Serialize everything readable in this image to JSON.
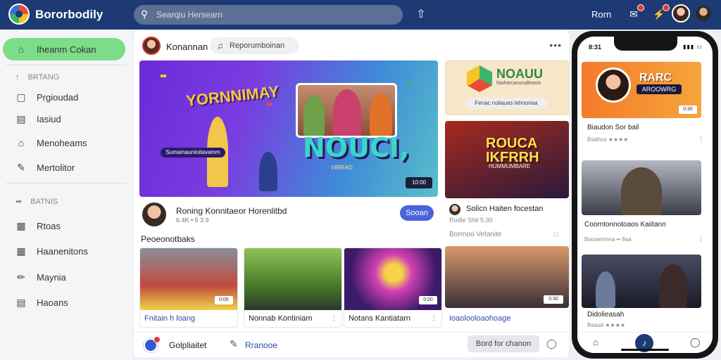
{
  "app": {
    "brand": "Bororbodily"
  },
  "search": {
    "placeholder": "Searqiu Hersearn"
  },
  "user": {
    "name": "Rorn"
  },
  "sidebar": {
    "active": {
      "label": "Iheanm Cokan"
    },
    "section1": {
      "heading": "BRTANG",
      "items": [
        {
          "label": "Prgioudad"
        },
        {
          "label": "Iasiud"
        },
        {
          "label": "Menoheams"
        },
        {
          "label": "Mertolitor"
        }
      ]
    },
    "section2": {
      "heading": "BATNIS",
      "items": [
        {
          "label": "Rtoas"
        },
        {
          "label": "Haanenitons"
        },
        {
          "label": "Maynia"
        },
        {
          "label": "Haoans"
        }
      ]
    }
  },
  "channel": {
    "owner": "Konannan",
    "chip": "Reporumboinan"
  },
  "hero": {
    "title": "YORNNIMAY",
    "big_text": "NOUCI,",
    "sub_text": "VIRRAO",
    "chip": "Sumamaunioitavamm",
    "duration": "10:00",
    "video_title": "Roning Konnitaeor Horenlitbd",
    "stats": "6.4K • 5 3.9",
    "subscribe": "Sooan"
  },
  "recommended": {
    "label": "Peoeonotbaks",
    "items": [
      {
        "caption": "Fnitain h loang",
        "duration": "0:00"
      },
      {
        "caption": "Nonnab Kontiniam",
        "duration": ""
      },
      {
        "caption": "Notans Kantiatarn",
        "duration": "0:00"
      }
    ]
  },
  "right": {
    "card1": {
      "title": "NOAUU",
      "subtitle": "Niaharcanonalleanis",
      "pill": "Fenac noliaues lehnonaa"
    },
    "card2": {
      "title": "ROUCA IKFRRH",
      "subtitle": "HUMMUMBARE"
    },
    "card2_caption": "Solicn Haiten focestan",
    "card2_stats": "Rodle  Shit  5:30",
    "recent_label": "Borrnoo Vetanite",
    "card3_duration": "0:30",
    "card3_caption": "Ioaolooloaohoage"
  },
  "bottom": {
    "label": "Golpliaitet",
    "link": "Rranooe",
    "button": "Bord for chanon"
  },
  "phone": {
    "time": "8:31",
    "card1": {
      "title": "RARC",
      "badge": "AROOWRG",
      "duration": "0:30"
    },
    "card1_caption": "Biaudon Sor bail",
    "card1_stats": "Bsiiihos ★★★★",
    "card2_caption": "Coorntonnotoaos Kaiitann",
    "card2_stats": "Boooenmna •• 8aa",
    "card3_caption": "Didolieasah",
    "card3_stats": "Beaud ★★★★"
  },
  "colors": {
    "topbar": "#1d3a75",
    "active": "#7ddc8a",
    "accent": "#4a63d6"
  }
}
